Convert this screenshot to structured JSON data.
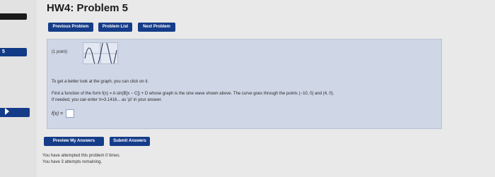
{
  "page": {
    "title": "HW4: Problem 5"
  },
  "sidebar": {
    "blue_tab_text": "5"
  },
  "nav": {
    "previous_label": "Previous Problem",
    "list_label": "Problem List",
    "next_label": "Next Problem"
  },
  "problem": {
    "points": "(1 point)",
    "hint": "To get a better look at the graph, you can click on it.",
    "instruction": "Find a function of the form f(x) = A sin(B[x − C]) + D whose graph is the sine wave shown above. The curve goes through the points (−10, 0) and (4, 0).",
    "pi_note": "If needed, you can enter π=3.1416... as 'pi' in your answer.",
    "answer_label": "f(x) ="
  },
  "actions": {
    "preview_label": "Preview My Answers",
    "submit_label": "Submit Answers"
  },
  "status": {
    "attempted": "You have attempted this problem 0 times.",
    "remaining": "You have 3 attempts remaining."
  }
}
